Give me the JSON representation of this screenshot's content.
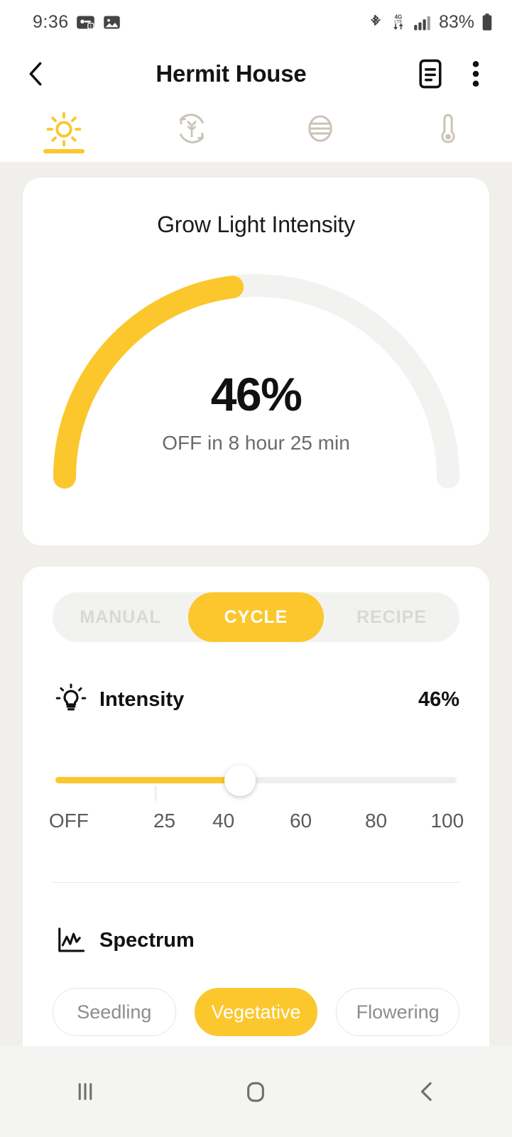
{
  "status_bar": {
    "time": "9:36",
    "battery_percent": "83%",
    "left_icons": [
      "notification-badge-icon",
      "gallery-image-icon"
    ],
    "right_icons": [
      "bluetooth-icon",
      "lte-data-icon",
      "signal-bars-icon",
      "battery-icon"
    ]
  },
  "header": {
    "title": "Hermit House",
    "back_icon": "chevron-left-icon",
    "notes_icon": "document-notes-icon",
    "overflow_icon": "more-vertical-icon"
  },
  "tabs": [
    {
      "name": "light",
      "icon": "sun-icon",
      "active": true
    },
    {
      "name": "grow-cycle",
      "icon": "leaf-cycle-icon",
      "active": false
    },
    {
      "name": "ventilation",
      "icon": "air-circle-icon",
      "active": false
    },
    {
      "name": "temperature",
      "icon": "thermometer-icon",
      "active": false
    }
  ],
  "gauge": {
    "title": "Grow Light Intensity",
    "value": "46%",
    "subtitle": "OFF in 8 hour 25 min",
    "percent": 46
  },
  "mode_tabs": {
    "options": [
      "MANUAL",
      "CYCLE",
      "RECIPE"
    ],
    "selected": "CYCLE"
  },
  "intensity": {
    "icon": "lightbulb-icon",
    "label": "Intensity",
    "value": "46%",
    "slider_percent": 46,
    "scale_labels": [
      "OFF",
      "25",
      "40",
      "60",
      "80",
      "100"
    ]
  },
  "spectrum": {
    "icon": "line-chart-icon",
    "label": "Spectrum",
    "chips": [
      "Seedling",
      "Vegetative",
      "Flowering"
    ],
    "selected": "Vegetative"
  },
  "nav_bar": {
    "recents_icon": "recents-icon",
    "home_icon": "home-icon",
    "back_icon": "back-icon"
  },
  "colors": {
    "accent": "#FBC72C",
    "page_bg": "#F0EFEC",
    "card_bg": "#FFFFFF",
    "track_bg": "#EFEFED",
    "muted_text": "#6B6B6B"
  }
}
